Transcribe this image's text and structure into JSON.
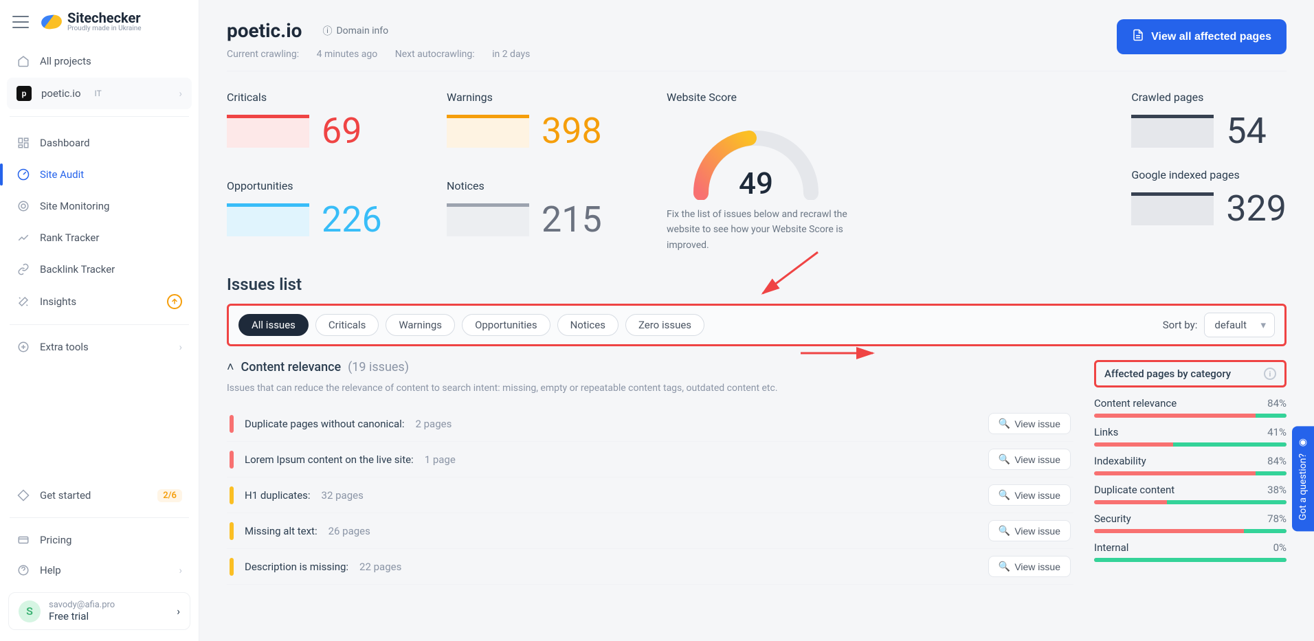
{
  "brand": {
    "name": "Sitechecker",
    "tagline": "Proudly made in Ukraine"
  },
  "sidebar": {
    "all_projects": "All projects",
    "project": {
      "name": "poetic.io",
      "tag": "IT",
      "avatar": "p"
    },
    "items": [
      {
        "label": "Dashboard"
      },
      {
        "label": "Site Audit"
      },
      {
        "label": "Site Monitoring"
      },
      {
        "label": "Rank Tracker"
      },
      {
        "label": "Backlink Tracker"
      },
      {
        "label": "Insights"
      }
    ],
    "extra_tools": "Extra tools",
    "get_started": {
      "label": "Get started",
      "badge": "2/6"
    },
    "pricing": "Pricing",
    "help": "Help",
    "user": {
      "email": "savody@afia.pro",
      "plan": "Free trial",
      "initial": "S"
    }
  },
  "header": {
    "domain": "poetic.io",
    "domain_info": "Domain info",
    "crawling_prefix": "Current crawling: ",
    "crawling_value": "4 minutes ago",
    "autocrawl_prefix": "Next autocrawling: ",
    "autocrawl_value": "in 2 days",
    "primary_button": "View all affected pages"
  },
  "stats": {
    "criticals": {
      "label": "Criticals",
      "value": "69"
    },
    "warnings": {
      "label": "Warnings",
      "value": "398"
    },
    "opportunities": {
      "label": "Opportunities",
      "value": "226"
    },
    "notices": {
      "label": "Notices",
      "value": "215"
    },
    "score": {
      "label": "Website Score",
      "value": "49",
      "desc": "Fix the list of issues below and recrawl the website to see how your Website Score is improved."
    },
    "crawled": {
      "label": "Crawled pages",
      "value": "54"
    },
    "indexed": {
      "label": "Google indexed pages",
      "value": "329"
    }
  },
  "issues": {
    "heading": "Issues list",
    "filters": [
      "All issues",
      "Criticals",
      "Warnings",
      "Opportunities",
      "Notices",
      "Zero issues"
    ],
    "sort_label": "Sort by:",
    "sort_value": "default",
    "group": {
      "name": "Content relevance",
      "count": "(19 issues)",
      "desc": "Issues that can reduce the relevance of content to search intent: missing, empty or repeatable content tags, outdated content etc."
    },
    "view_issue_label": "View issue",
    "rows": [
      {
        "sev": "red",
        "title": "Duplicate pages without canonical:",
        "pages": "2 pages"
      },
      {
        "sev": "red",
        "title": "Lorem Ipsum content on the live site:",
        "pages": "1 page"
      },
      {
        "sev": "orange",
        "title": "H1 duplicates:",
        "pages": "32 pages"
      },
      {
        "sev": "orange",
        "title": "Missing alt text:",
        "pages": "26 pages"
      },
      {
        "sev": "orange",
        "title": "Description is missing:",
        "pages": "22 pages"
      }
    ]
  },
  "categories": {
    "title": "Affected pages by category",
    "items": [
      {
        "name": "Content relevance",
        "pct": "84%",
        "fill": 16
      },
      {
        "name": "Links",
        "pct": "41%",
        "fill": 59
      },
      {
        "name": "Indexability",
        "pct": "84%",
        "fill": 16
      },
      {
        "name": "Duplicate content",
        "pct": "38%",
        "fill": 62
      },
      {
        "name": "Security",
        "pct": "78%",
        "fill": 22
      },
      {
        "name": "Internal",
        "pct": "0%",
        "fill": 100
      }
    ]
  },
  "feedback_tab": "Got a question?"
}
